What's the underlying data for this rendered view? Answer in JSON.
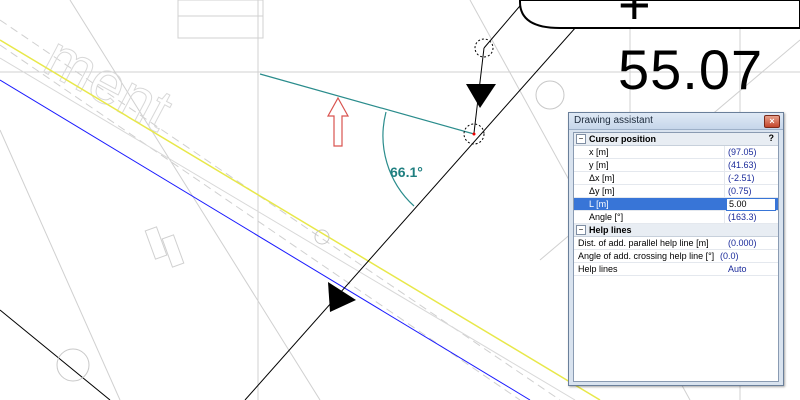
{
  "canvas": {
    "angle_label": "66.1°",
    "large_label": "+ 55.07"
  },
  "assistant": {
    "title": "Drawing assistant",
    "close_glyph": "×",
    "help_glyph": "?",
    "cursor_section": {
      "title": "Cursor position",
      "toggle": "−",
      "rows": [
        {
          "label": "x [m]",
          "value": "(97.05)"
        },
        {
          "label": "y [m]",
          "value": "(41.63)"
        },
        {
          "label": "Δx [m]",
          "value": "(-2.51)"
        },
        {
          "label": "Δy [m]",
          "value": "(0.75)"
        },
        {
          "label": "L [m]",
          "value": "5.00"
        },
        {
          "label": "Angle [°]",
          "value": "(163.3)"
        }
      ]
    },
    "help_section": {
      "title": "Help lines",
      "toggle": "−",
      "rows": [
        {
          "label": "Dist. of add. parallel help line [m]",
          "value": "(0.000)"
        },
        {
          "label": "Angle of add. crossing help line [°]",
          "value": "(0.0)"
        },
        {
          "label": "Help lines",
          "value": "Auto"
        }
      ]
    }
  },
  "colors": {
    "teal_line": "#2a8c8c",
    "yellow_line": "#e8e84a",
    "blue_line": "#1a1aff",
    "arrow_red": "#d9534f",
    "selection": "#3875d7"
  }
}
